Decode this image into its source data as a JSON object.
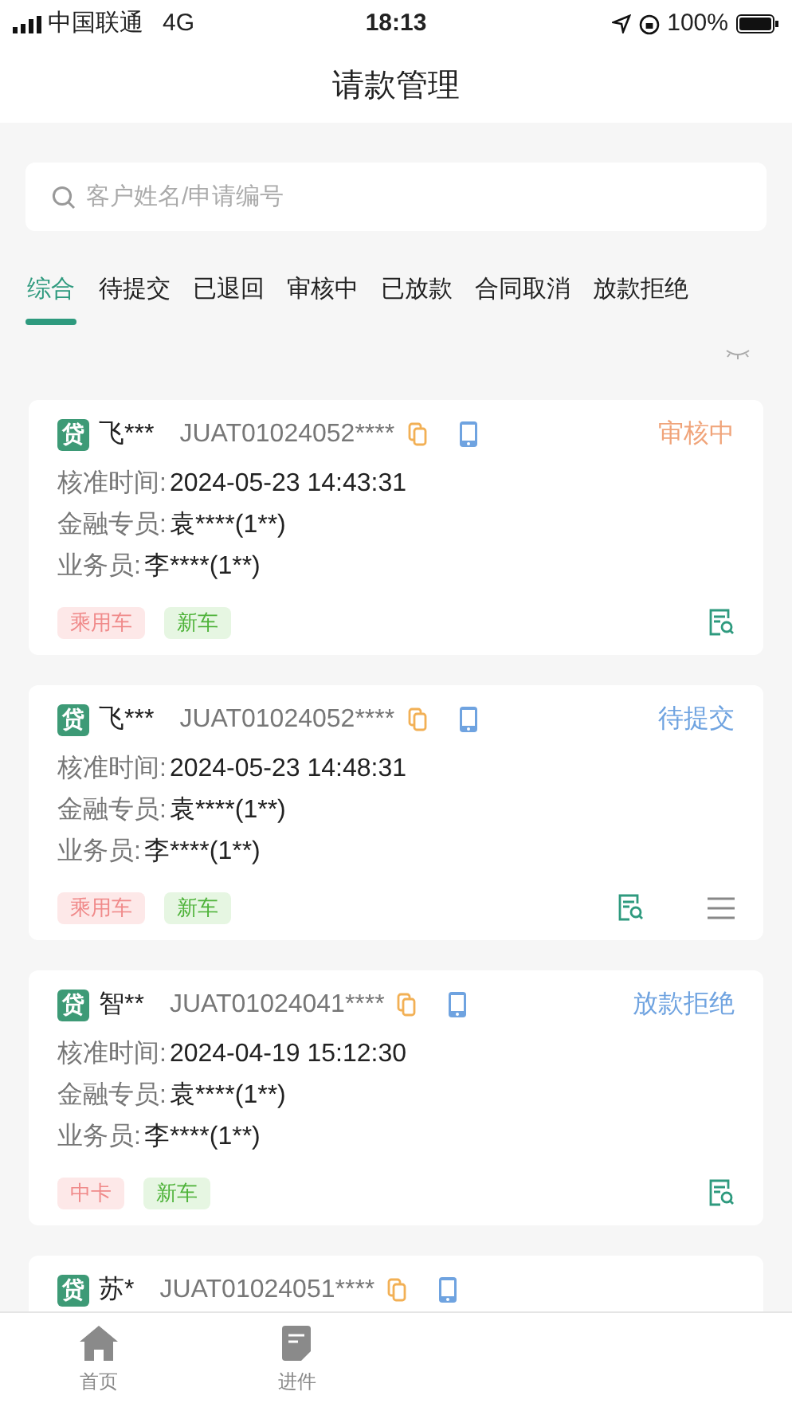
{
  "status_bar": {
    "carrier": "中国联通",
    "network": "4G",
    "time": "18:13",
    "battery": "100%"
  },
  "title": "请款管理",
  "search": {
    "placeholder": "客户姓名/申请编号"
  },
  "tabs": [
    {
      "label": "综合",
      "selected": true
    },
    {
      "label": "待提交",
      "selected": false
    },
    {
      "label": "已退回",
      "selected": false
    },
    {
      "label": "审核中",
      "selected": false
    },
    {
      "label": "已放款",
      "selected": false
    },
    {
      "label": "合同取消",
      "selected": false
    },
    {
      "label": "放款拒绝",
      "selected": false
    }
  ],
  "cards": [
    {
      "badge": "贷",
      "name": "飞***",
      "number": "JUAT01024052****",
      "status": "审核中",
      "color": "#f0a47a",
      "fields": [
        {
          "label": "核准时间:",
          "value": "2024-05-23 14:43:31"
        },
        {
          "label": "金融专员:",
          "value": "袁****(1**)"
        },
        {
          "label": "业务员:",
          "value": "李****(1**)"
        }
      ],
      "tags": [
        {
          "label": "乘用车",
          "kind": "vehicle"
        },
        {
          "label": "新车",
          "kind": "condition"
        }
      ],
      "menu": false
    },
    {
      "badge": "贷",
      "name": "飞***",
      "number": "JUAT01024052****",
      "status": "待提交",
      "color": "#6fa3e0",
      "fields": [
        {
          "label": "核准时间:",
          "value": "2024-05-23 14:48:31"
        },
        {
          "label": "金融专员:",
          "value": "袁****(1**)"
        },
        {
          "label": "业务员:",
          "value": "李****(1**)"
        }
      ],
      "tags": [
        {
          "label": "乘用车",
          "kind": "vehicle"
        },
        {
          "label": "新车",
          "kind": "condition"
        }
      ],
      "menu": true
    },
    {
      "badge": "贷",
      "name": "智**",
      "number": "JUAT01024041****",
      "status": "放款拒绝",
      "color": "#6fa3e0",
      "fields": [
        {
          "label": "核准时间:",
          "value": "2024-04-19 15:12:30"
        },
        {
          "label": "金融专员:",
          "value": "袁****(1**)"
        },
        {
          "label": "业务员:",
          "value": "李****(1**)"
        }
      ],
      "tags": [
        {
          "label": "中卡",
          "kind": "vehicle"
        },
        {
          "label": "新车",
          "kind": "condition"
        }
      ],
      "menu": false
    },
    {
      "badge": "贷",
      "name": "苏*",
      "number": "JUAT01024051****"
    }
  ],
  "tab_bar": [
    {
      "label": "首页",
      "kind": "home"
    },
    {
      "label": "进件",
      "kind": "form"
    }
  ]
}
